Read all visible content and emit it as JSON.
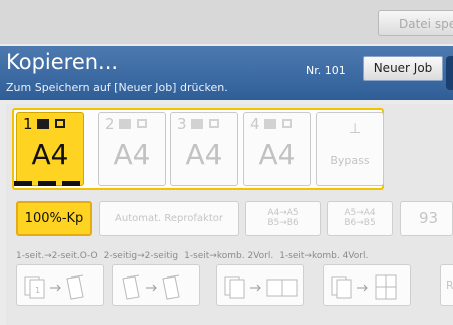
{
  "topbar": {
    "datei_label": "Datei spe"
  },
  "header": {
    "title": "Kopieren...",
    "subtitle": "Zum Speichern auf [Neuer Job] drücken.",
    "nr": "Nr. 101",
    "neuer_job": "Neuer Job"
  },
  "trays": [
    {
      "num": "1",
      "size": "A4",
      "selected": true
    },
    {
      "num": "2",
      "size": "A4",
      "selected": false
    },
    {
      "num": "3",
      "size": "A4",
      "selected": false
    },
    {
      "num": "4",
      "size": "A4",
      "selected": false
    }
  ],
  "bypass": {
    "label": "Bypass"
  },
  "zoom": {
    "selected_label": "100%-Kp",
    "auto_label": "Automat. Reprofaktor",
    "a4a5": {
      "line1": "A4→A5",
      "line2": "B5→B6"
    },
    "a5a4": {
      "line1": "A5→A4",
      "line2": "B6→B5"
    },
    "pct": "93"
  },
  "duplex": {
    "labels": [
      "1-seit.→2-seit.O-O",
      "2-seitig→2-seitig",
      "1-seit→komb. 2Vorl.",
      "1-seit→komb. 4Vorl."
    ],
    "rand": "Rand"
  },
  "colors": {
    "header": "#3a67a3",
    "selected": "#ffd321",
    "accent_border": "#f1c300"
  }
}
